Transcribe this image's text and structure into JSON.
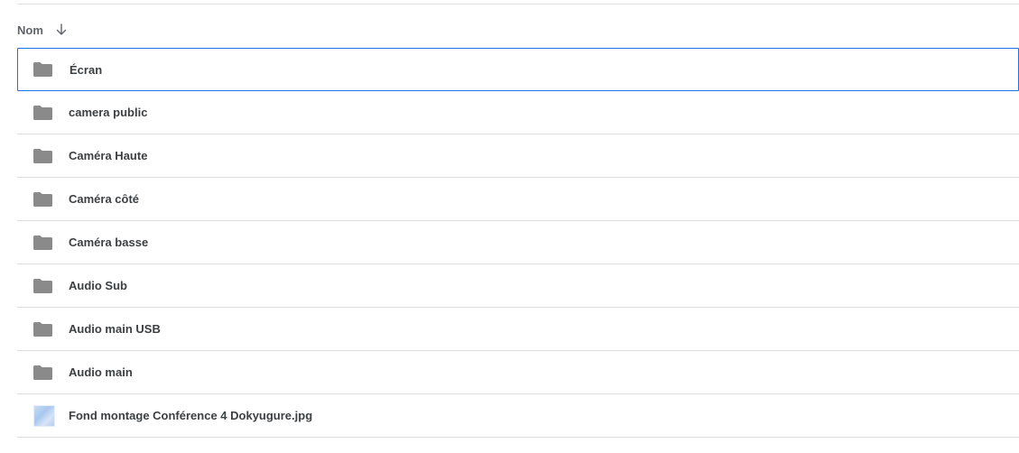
{
  "header": {
    "name_label": "Nom",
    "sort_icon": "arrow-down-icon"
  },
  "items": [
    {
      "label": "Écran",
      "type": "folder",
      "icon": "folder-icon",
      "selected": true
    },
    {
      "label": "camera public",
      "type": "folder",
      "icon": "folder-icon",
      "selected": false
    },
    {
      "label": "Caméra Haute",
      "type": "folder",
      "icon": "folder-icon",
      "selected": false
    },
    {
      "label": "Caméra côté",
      "type": "folder",
      "icon": "folder-icon",
      "selected": false
    },
    {
      "label": "Caméra basse",
      "type": "folder",
      "icon": "folder-icon",
      "selected": false
    },
    {
      "label": "Audio Sub",
      "type": "folder",
      "icon": "folder-icon",
      "selected": false
    },
    {
      "label": "Audio main USB",
      "type": "folder",
      "icon": "folder-icon",
      "selected": false
    },
    {
      "label": "Audio main",
      "type": "folder",
      "icon": "folder-icon",
      "selected": false
    },
    {
      "label": "Fond montage Conférence 4 Dokyugure.jpg",
      "type": "image",
      "icon": "image-thumbnail-icon",
      "selected": false
    }
  ],
  "colors": {
    "selection_border": "#1a73e8",
    "folder_icon": "#8a8a8a",
    "divider": "#dadce0",
    "text": "#3c4043"
  }
}
